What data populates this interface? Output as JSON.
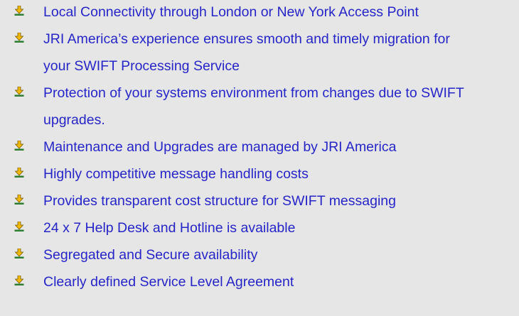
{
  "bullets": {
    "icon": "down-arrow-bullet-icon",
    "arrow_color": "#f2bb00",
    "arrow_outline": "#7a5a00",
    "base_color": "#2e7d32",
    "text_color": "#2525c8",
    "background": "#e6e6e6"
  },
  "items": [
    "Local Connectivity through London or New York Access Point",
    "JRI America’s experience ensures smooth and timely migration for your SWIFT Processing Service",
    "Protection of your systems environment from changes due to SWIFT upgrades.",
    "Maintenance and Upgrades are managed by JRI America",
    "Highly competitive message handling costs",
    "Provides transparent cost structure for SWIFT messaging",
    "24 x 7 Help Desk and Hotline is available",
    "Segregated and Secure availability",
    "Clearly defined Service Level Agreement"
  ]
}
